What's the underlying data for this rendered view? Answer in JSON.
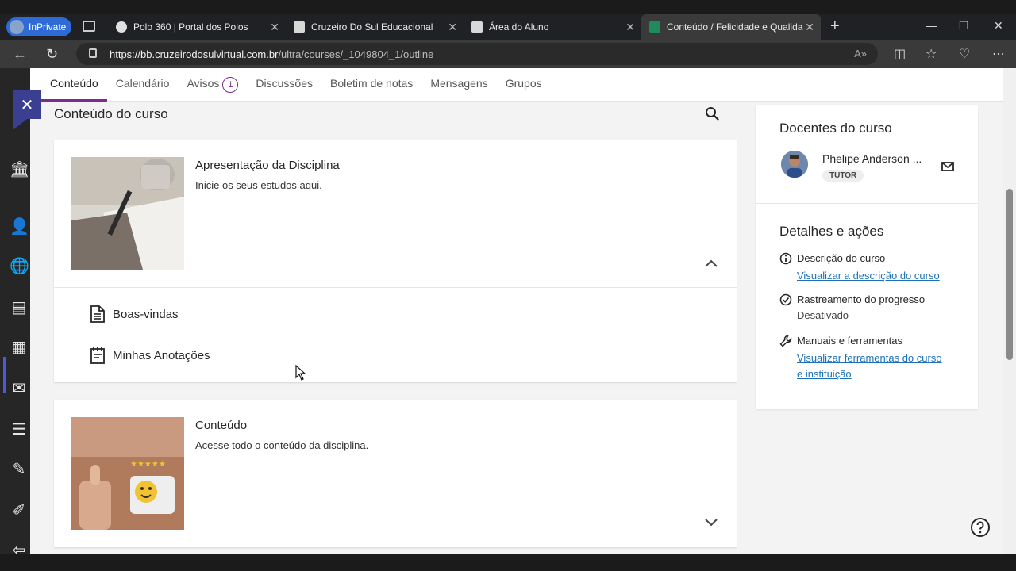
{
  "browser": {
    "inprivate_label": "InPrivate",
    "tabs": [
      {
        "title": "Polo 360 | Portal dos Polos",
        "active": false
      },
      {
        "title": "Cruzeiro Do Sul Educacional",
        "active": false
      },
      {
        "title": "Área do Aluno",
        "active": false
      },
      {
        "title": "Conteúdo / Felicidade e Qualidade",
        "active": true
      }
    ],
    "url_host": "https://bb.cruzeirodosulvirtual.com.br",
    "url_path": "/ultra/courses/_1049804_1/outline"
  },
  "course_tabs": [
    {
      "label": "Conteúdo",
      "active": true
    },
    {
      "label": "Calendário"
    },
    {
      "label": "Avisos",
      "badge": "1"
    },
    {
      "label": "Discussões"
    },
    {
      "label": "Boletim de notas"
    },
    {
      "label": "Mensagens"
    },
    {
      "label": "Grupos"
    }
  ],
  "main": {
    "section_title": "Conteúdo do curso",
    "cards": [
      {
        "title": "Apresentação da Disciplina",
        "description": "Inicie os seus estudos aqui.",
        "expanded": true,
        "items": [
          "Boas-vindas",
          "Minhas Anotações"
        ]
      },
      {
        "title": "Conteúdo",
        "description": "Acesse todo o conteúdo da disciplina.",
        "expanded": false
      }
    ]
  },
  "side": {
    "teachers_title": "Docentes do curso",
    "tutor_name": "Phelipe Anderson ...",
    "tutor_role": "TUTOR",
    "details_title": "Detalhes e ações",
    "details": [
      {
        "label": "Descrição do curso",
        "link": "Visualizar a descrição do curso"
      },
      {
        "label": "Rastreamento do progresso",
        "value": "Desativado"
      },
      {
        "label": "Manuais e ferramentas",
        "link_line1": "Visualizar ferramentas do curso",
        "link_line2": "e instituição"
      }
    ]
  },
  "colors": {
    "accent": "#7c2a8c",
    "rail_active": "#3a3f92",
    "link": "#1d71b8"
  }
}
